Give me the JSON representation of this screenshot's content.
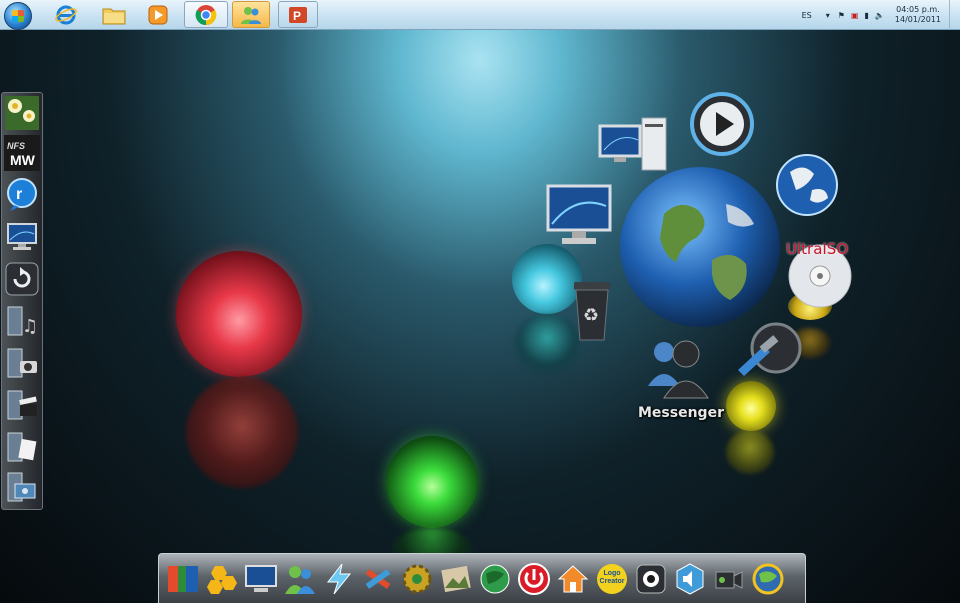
{
  "taskbar": {
    "items": [
      {
        "name": "start-button",
        "icon": "windows-orb-icon"
      },
      {
        "name": "internet-explorer",
        "icon": "ie-icon"
      },
      {
        "name": "windows-explorer",
        "icon": "folder-icon"
      },
      {
        "name": "media-player",
        "icon": "media-player-icon"
      },
      {
        "name": "google-chrome",
        "icon": "chrome-icon"
      },
      {
        "name": "windows-live-messenger",
        "icon": "messenger-icon"
      },
      {
        "name": "powerpoint",
        "icon": "powerpoint-icon"
      }
    ],
    "tray": {
      "language": "ES",
      "time": "04:05 p.m.",
      "date": "14/01/2011"
    }
  },
  "desktop": {
    "labels": {
      "messenger": "Messenger",
      "ultraiso": "UltraISO"
    },
    "colors": {
      "red_sphere": "#e83848",
      "green_sphere": "#3bdc3b",
      "cyan_sphere": "#45c8e0",
      "yellow_sphere": "#e6e01e"
    }
  },
  "left_dock": {
    "items": [
      "flowers-icon",
      "nfs-mw-icon",
      "realplayer-icon",
      "monitor-icon",
      "refresh-icon",
      "music-icon",
      "camera-icon",
      "video-icon",
      "documents-icon",
      "network-icon"
    ],
    "nfs_label": "MW"
  },
  "bottom_dock": {
    "items": [
      "avg-icon",
      "hex-app-icon",
      "monitor-icon",
      "messenger-icon",
      "lightning-icon",
      "tools-icon",
      "gear-icon",
      "image-editor-icon",
      "globe-icon",
      "power-icon",
      "home-icon",
      "logo-creator-icon",
      "webcam-icon",
      "speaker-icon",
      "camcorder-icon",
      "globe-gold-icon"
    ],
    "logo_creator_text": "Logo Creator"
  }
}
